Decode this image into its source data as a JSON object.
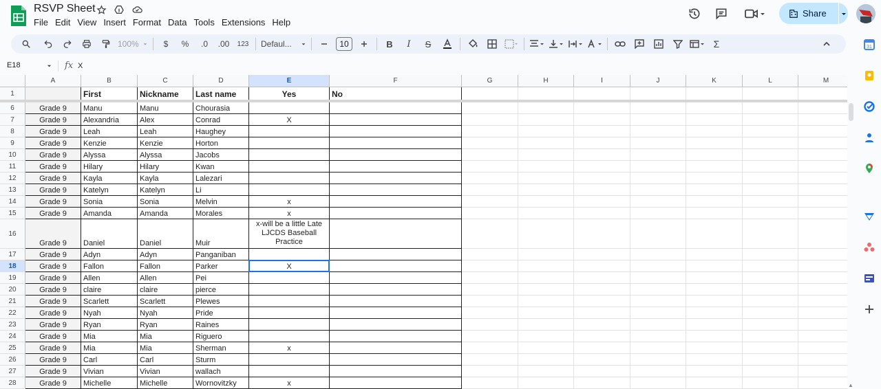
{
  "doc": {
    "title": "RSVP Sheet"
  },
  "menu": [
    "File",
    "Edit",
    "View",
    "Insert",
    "Format",
    "Data",
    "Tools",
    "Extensions",
    "Help"
  ],
  "share": {
    "label": "Share"
  },
  "toolbar": {
    "zoom": "100%",
    "currency": "$",
    "percent": "%",
    "dec_decrease": ".0",
    "dec_increase": ".00",
    "number_format": "123",
    "font": "Defaul...",
    "font_size": "10"
  },
  "formula": {
    "cell_ref": "E18",
    "value": "X"
  },
  "columns": [
    "A",
    "B",
    "C",
    "D",
    "E",
    "F",
    "G",
    "H",
    "I",
    "J",
    "K",
    "L",
    "M"
  ],
  "header_row": {
    "row": "1",
    "A": "",
    "B": "First",
    "C": "Nickname",
    "D": "Last name",
    "E": "Yes",
    "F": "No"
  },
  "rows": [
    {
      "n": "6",
      "A": "Grade 9",
      "B": "Manu",
      "C": "Manu",
      "D": "Chourasia",
      "E": ""
    },
    {
      "n": "7",
      "A": "Grade 9",
      "B": "Alexandria",
      "C": "Alex",
      "D": "Conrad",
      "E": "X"
    },
    {
      "n": "8",
      "A": "Grade 9",
      "B": "Leah",
      "C": "Leah",
      "D": "Haughey",
      "E": ""
    },
    {
      "n": "9",
      "A": "Grade 9",
      "B": "Kenzie",
      "C": "Kenzie",
      "D": "Horton",
      "E": ""
    },
    {
      "n": "10",
      "A": "Grade 9",
      "B": "Alyssa",
      "C": "Alyssa",
      "D": "Jacobs",
      "E": ""
    },
    {
      "n": "11",
      "A": "Grade 9",
      "B": "Hilary",
      "C": "Hilary",
      "D": "Kwan",
      "E": ""
    },
    {
      "n": "12",
      "A": "Grade 9",
      "B": "Kayla",
      "C": "Kayla",
      "D": "Lalezari",
      "E": ""
    },
    {
      "n": "13",
      "A": "Grade 9",
      "B": "Katelyn",
      "C": "Katelyn",
      "D": "Li",
      "E": ""
    },
    {
      "n": "14",
      "A": "Grade 9",
      "B": "Sonia",
      "C": "Sonia",
      "D": "Melvin",
      "E": "x"
    },
    {
      "n": "15",
      "A": "Grade 9",
      "B": "Amanda",
      "C": "Amanda",
      "D": "Morales",
      "E": "x"
    },
    {
      "n": "16",
      "A": "Grade 9",
      "B": "Daniel",
      "C": "Daniel",
      "D": "Muir",
      "E": "x-will be a little Late LJCDS Baseball Practice"
    },
    {
      "n": "17",
      "A": "Grade 9",
      "B": "Adyn",
      "C": "Adyn",
      "D": "Panganiban",
      "E": ""
    },
    {
      "n": "18",
      "A": "Grade 9",
      "B": "Fallon",
      "C": "Fallon",
      "D": "Parker",
      "E": "X"
    },
    {
      "n": "19",
      "A": "Grade 9",
      "B": "Allen",
      "C": "Allen",
      "D": "Pei",
      "E": ""
    },
    {
      "n": "20",
      "A": "Grade 9",
      "B": "claire",
      "C": "claire",
      "D": "pierce",
      "E": ""
    },
    {
      "n": "21",
      "A": "Grade 9",
      "B": "Scarlett",
      "C": "Scarlett",
      "D": "Plewes",
      "E": ""
    },
    {
      "n": "22",
      "A": "Grade 9",
      "B": "Nyah",
      "C": "Nyah",
      "D": "Pride",
      "E": ""
    },
    {
      "n": "23",
      "A": "Grade 9",
      "B": "Ryan",
      "C": "Ryan",
      "D": "Raines",
      "E": ""
    },
    {
      "n": "24",
      "A": "Grade 9",
      "B": "Mia",
      "C": "Mia",
      "D": "Riguero",
      "E": ""
    },
    {
      "n": "25",
      "A": "Grade 9",
      "B": "Mia",
      "C": "Mia",
      "D": "Sherman",
      "E": "x"
    },
    {
      "n": "26",
      "A": "Grade 9",
      "B": "Carl",
      "C": "Carl",
      "D": "Sturm",
      "E": ""
    },
    {
      "n": "27",
      "A": "Grade 9",
      "B": "Vivian",
      "C": "Vivian",
      "D": "wallach",
      "E": ""
    },
    {
      "n": "28",
      "A": "Grade 9",
      "B": "Michelle",
      "C": "Michelle",
      "D": "Wornovitzky",
      "E": "x"
    }
  ]
}
